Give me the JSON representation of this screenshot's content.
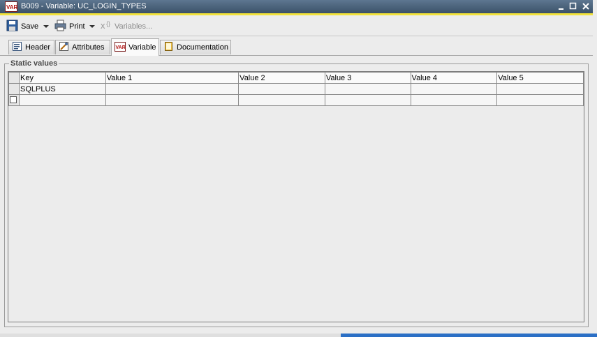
{
  "window": {
    "title": "B009 - Variable: UC_LOGIN_TYPES",
    "app_icon": "var-icon",
    "controls": [
      "minimize-icon",
      "maximize-icon",
      "close-icon"
    ]
  },
  "toolbar": {
    "save_label": "Save",
    "print_label": "Print",
    "variables_label": "Variables..."
  },
  "tabs": [
    {
      "label": "Header",
      "icon": "header-icon",
      "active": false
    },
    {
      "label": "Attributes",
      "icon": "attributes-icon",
      "active": false
    },
    {
      "label": "Variable",
      "icon": "var-icon",
      "active": true
    },
    {
      "label": "Documentation",
      "icon": "documentation-icon",
      "active": false
    }
  ],
  "static_values": {
    "group_label": "Static values",
    "columns": [
      "Key",
      "Value 1",
      "Value 2",
      "Value 3",
      "Value 4",
      "Value 5"
    ],
    "rows": [
      [
        "SQLPLUS",
        "",
        "",
        "",
        "",
        ""
      ],
      [
        "",
        "",
        "",
        "",
        "",
        ""
      ]
    ]
  },
  "colors": {
    "titlebar": "#4a6079",
    "accent_line": "#f2e23b",
    "selection_strip": "#2b6fc5"
  }
}
